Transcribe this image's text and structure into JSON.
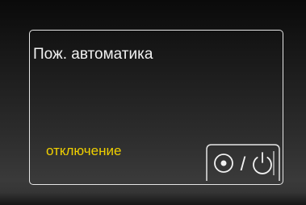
{
  "panel": {
    "title": "Пож. автоматика",
    "status": "отключение",
    "status_color": "#f0d000"
  },
  "toggle": {
    "icon": "on-off-toggle-icon",
    "separator": "/"
  }
}
